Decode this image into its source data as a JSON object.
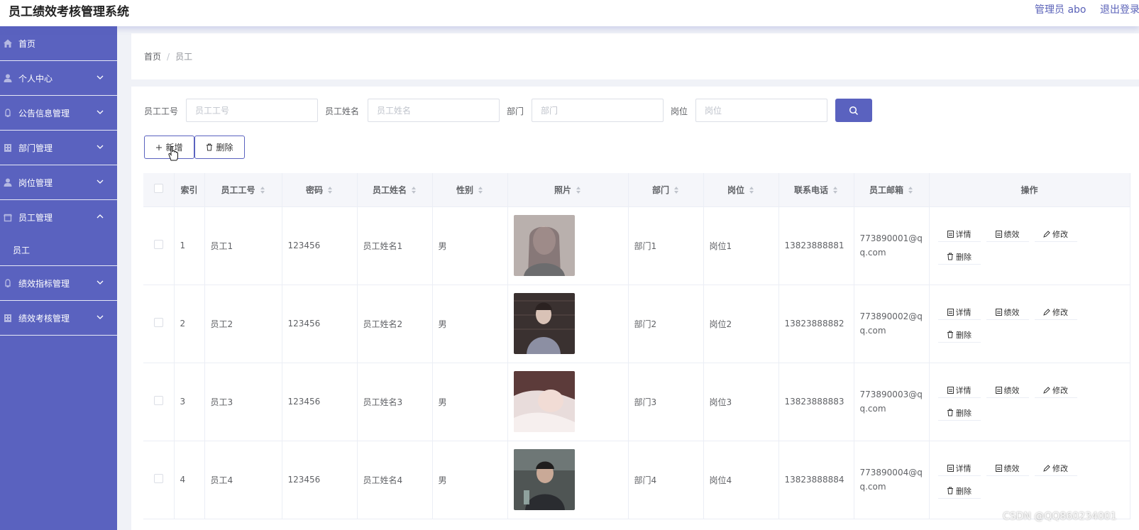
{
  "app": {
    "title": "员工绩效考核管理系统",
    "admin": "管理员 abo",
    "logout": "退出登录"
  },
  "sidebar": {
    "items": [
      {
        "label": "首页",
        "icon": "home-icon",
        "expandable": false
      },
      {
        "label": "个人中心",
        "icon": "user-icon",
        "expandable": true
      },
      {
        "label": "公告信息管理",
        "icon": "bell-icon",
        "expandable": true
      },
      {
        "label": "部门管理",
        "icon": "building-icon",
        "expandable": true
      },
      {
        "label": "岗位管理",
        "icon": "user-icon",
        "expandable": true
      },
      {
        "label": "员工管理",
        "icon": "frame-icon",
        "expandable": true,
        "expanded": true,
        "children": [
          "员工"
        ]
      },
      {
        "label": "绩效指标管理",
        "icon": "bell-icon",
        "expandable": true
      },
      {
        "label": "绩效考核管理",
        "icon": "building-icon",
        "expandable": true
      }
    ]
  },
  "breadcrumb": {
    "home": "首页",
    "sep": "/",
    "current": "员工"
  },
  "filters": [
    {
      "label": "员工工号",
      "placeholder": "员工工号"
    },
    {
      "label": "员工姓名",
      "placeholder": "员工姓名"
    },
    {
      "label": "部门",
      "placeholder": "部门"
    },
    {
      "label": "岗位",
      "placeholder": "岗位"
    }
  ],
  "actions": {
    "add": "新增",
    "delete": "删除"
  },
  "table": {
    "headers": [
      "索引",
      "员工工号",
      "密码",
      "员工姓名",
      "性别",
      "照片",
      "部门",
      "岗位",
      "联系电话",
      "员工邮箱",
      "操作"
    ],
    "rows": [
      {
        "index": "1",
        "empno": "员工1",
        "password": "123456",
        "name": "员工姓名1",
        "gender": "男",
        "dept": "部门1",
        "post": "岗位1",
        "phone": "13823888881",
        "email": "773890001@qq.com"
      },
      {
        "index": "2",
        "empno": "员工2",
        "password": "123456",
        "name": "员工姓名2",
        "gender": "男",
        "dept": "部门2",
        "post": "岗位2",
        "phone": "13823888882",
        "email": "773890002@qq.com"
      },
      {
        "index": "3",
        "empno": "员工3",
        "password": "123456",
        "name": "员工姓名3",
        "gender": "男",
        "dept": "部门3",
        "post": "岗位3",
        "phone": "13823888883",
        "email": "773890003@qq.com"
      },
      {
        "index": "4",
        "empno": "员工4",
        "password": "123456",
        "name": "员工姓名4",
        "gender": "男",
        "dept": "部门4",
        "post": "岗位4",
        "phone": "13823888884",
        "email": "773890004@qq.com"
      }
    ],
    "row_actions": {
      "detail": "详情",
      "perf": "绩效",
      "edit": "修改",
      "del": "删除"
    }
  },
  "watermark": "CSDN @QQ860234001",
  "colors": {
    "accent": "#5a62bf",
    "header_bg": "#ffffff",
    "page_bg": "#f0f2f7"
  }
}
